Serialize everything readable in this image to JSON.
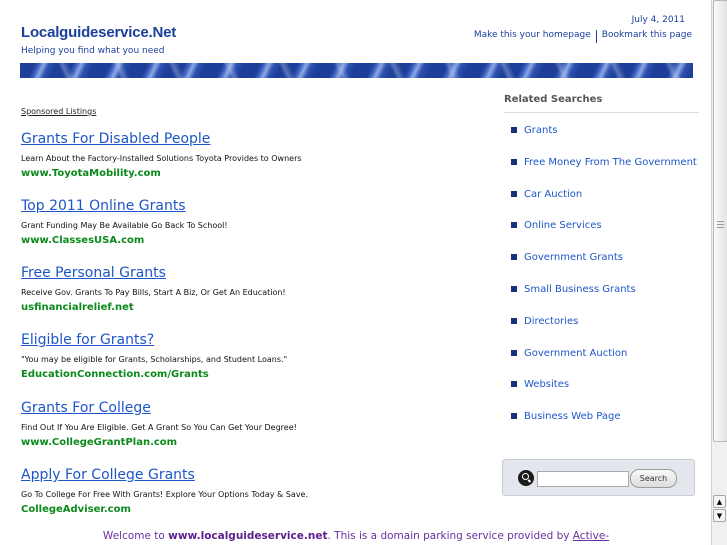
{
  "header": {
    "site_title": "Localguideservice.Net",
    "tagline": "Helping you find what you need",
    "date": "July 4, 2011",
    "homepage_link": "Make this your homepage",
    "bookmark_link": "Bookmark this page"
  },
  "sponsored_label": "Sponsored Listings",
  "listings": [
    {
      "title": "Grants For Disabled People",
      "description": "Learn About the Factory-Installed Solutions Toyota Provides to Owners",
      "url": "www.ToyotaMobility.com"
    },
    {
      "title": "Top 2011 Online Grants",
      "description": "Grant Funding May Be Available Go Back To School!",
      "url": "www.ClassesUSA.com"
    },
    {
      "title": "Free Personal Grants",
      "description": "Receive Gov. Grants To Pay Bills, Start A Biz, Or Get An Education!",
      "url": "usfinancialrelief.net"
    },
    {
      "title": "Eligible for Grants?",
      "description": "\"You may be eligible for Grants, Scholarships, and Student Loans.\"",
      "url": "EducationConnection.com/Grants"
    },
    {
      "title": "Grants For College",
      "description": "Find Out If You Are Eligible. Get A Grant So You Can Get Your Degree!",
      "url": "www.CollegeGrantPlan.com"
    },
    {
      "title": "Apply For College Grants",
      "description": "Go To College For Free With Grants! Explore Your Options Today & Save.",
      "url": "CollegeAdviser.com"
    }
  ],
  "related": {
    "title": "Related Searches",
    "items": [
      "Grants",
      "Free Money From The Government",
      "Car Auction",
      "Online Services",
      "Government Grants",
      "Small Business Grants",
      "Directories",
      "Government Auction",
      "Websites",
      "Business Web Page"
    ]
  },
  "search": {
    "placeholder": "",
    "button_label": "Search"
  },
  "footer": {
    "prefix": "Welcome to ",
    "domain": "www.localguideservice.net",
    "middle": ". This is a domain parking service provided by ",
    "provider_link": "Active-"
  },
  "icons": {
    "search": "search-icon",
    "bullet": "square-bullet-icon",
    "scroll_up": "arrow-up-icon",
    "scroll_down": "arrow-down-icon"
  },
  "colors": {
    "title_blue": "#1a3f9c",
    "link_blue": "#1e56c8",
    "url_green": "#0a8a1a",
    "footer_purple": "#6b2fa0"
  }
}
